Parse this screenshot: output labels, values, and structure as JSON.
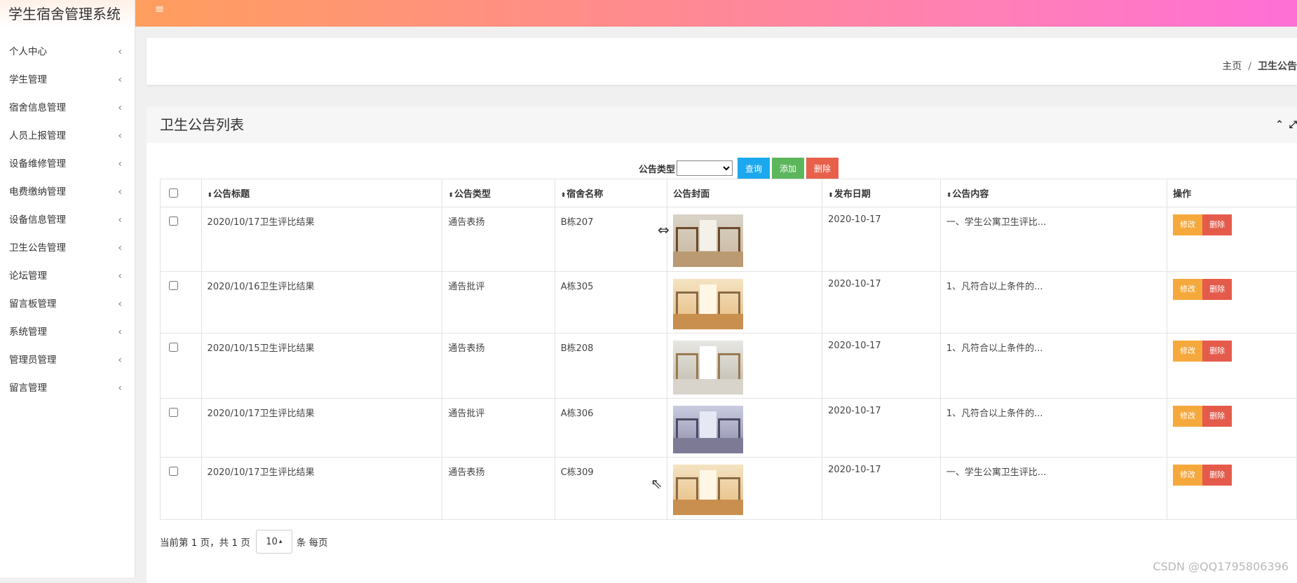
{
  "app": {
    "title": "学生宿舍管理系统"
  },
  "sidebar": {
    "items": [
      {
        "label": "个人中心"
      },
      {
        "label": "学生管理"
      },
      {
        "label": "宿舍信息管理"
      },
      {
        "label": "人员上报管理"
      },
      {
        "label": "设备维修管理"
      },
      {
        "label": "电费缴纳管理"
      },
      {
        "label": "设备信息管理"
      },
      {
        "label": "卫生公告管理"
      },
      {
        "label": "论坛管理"
      },
      {
        "label": "留言板管理"
      },
      {
        "label": "系统管理"
      },
      {
        "label": "管理员管理"
      },
      {
        "label": "留言管理"
      }
    ],
    "chevron": "‹"
  },
  "topbar": {
    "menu_icon": "≡"
  },
  "breadcrumb": {
    "home": "主页",
    "sep": "/",
    "current": "卫生公告"
  },
  "panel": {
    "title": "卫生公告列表",
    "collapse_icon": "⌃",
    "extra_icon": "⤢"
  },
  "filter": {
    "label": "公告类型",
    "select_value": "",
    "query": "查询",
    "add": "添加",
    "delete": "删除"
  },
  "table": {
    "sort_glyph": "⬍",
    "headers": {
      "title": "公告标题",
      "type": "公告类型",
      "dorm": "宿舍名称",
      "cover": "公告封面",
      "date": "发布日期",
      "content": "公告内容",
      "ops": "操作"
    },
    "rows": [
      {
        "title": "2020/10/17卫生评比结果",
        "type": "通告表扬",
        "dorm": "B栋207",
        "date": "2020-10-17",
        "content": "一、学生公寓卫生评比..."
      },
      {
        "title": "2020/10/16卫生评比结果",
        "type": "通告批评",
        "dorm": "A栋305",
        "date": "2020-10-17",
        "content": "1、凡符合以上条件的..."
      },
      {
        "title": "2020/10/15卫生评比结果",
        "type": "通告表扬",
        "dorm": "B栋208",
        "date": "2020-10-17",
        "content": "1、凡符合以上条件的..."
      },
      {
        "title": "2020/10/17卫生评比结果",
        "type": "通告批评",
        "dorm": "A栋306",
        "date": "2020-10-17",
        "content": "1、凡符合以上条件的..."
      },
      {
        "title": "2020/10/17卫生评比结果",
        "type": "通告表扬",
        "dorm": "C栋309",
        "date": "2020-10-17",
        "content": "一、学生公寓卫生评比..."
      }
    ],
    "edit": "修改",
    "del": "删除"
  },
  "pager": {
    "info": "当前第 1 页，共 1 页",
    "size": "10",
    "size_arrow": "▴",
    "suffix": "条 每页"
  },
  "watermark": "CSDN @QQ1795806396",
  "colors": {
    "topbar_start": "#ff9e5e",
    "topbar_end": "#ff6fd6",
    "query": "#1ba8ee",
    "add": "#5cb65c",
    "danger": "#e8604a",
    "edit": "#f5a93c"
  }
}
